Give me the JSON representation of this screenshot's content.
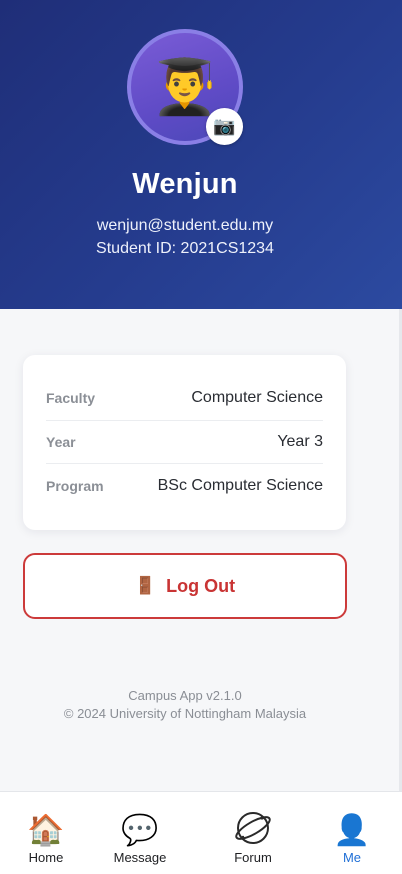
{
  "profile": {
    "avatar_emoji": "👨‍🎓",
    "camera_emoji": "📷",
    "name": "Wenjun",
    "email": "wenjun@student.edu.my",
    "student_id": "Student ID: 2021CS1234"
  },
  "info": {
    "rows": [
      {
        "label": "Faculty",
        "value": "Computer Science"
      },
      {
        "label": "Year",
        "value": "Year 3"
      },
      {
        "label": "Program",
        "value": "BSc Computer Science"
      }
    ]
  },
  "logout": {
    "icon": "🚪",
    "label": "Log Out"
  },
  "footer": {
    "version": "Campus App v2.1.0",
    "copyright": "© 2024 University of Nottingham Malaysia"
  },
  "tabs": [
    {
      "label": "Home",
      "icon": "🏠",
      "icon_name": "home-icon"
    },
    {
      "label": "Message",
      "icon": "💬",
      "icon_name": "message-icon"
    },
    {
      "label": "Forum",
      "icon": "planet-outline",
      "icon_name": "forum-icon"
    },
    {
      "label": "Me",
      "icon": "👤",
      "icon_name": "me-icon",
      "active": true
    }
  ],
  "colors": {
    "header_gradient_start": "#1f2e78",
    "header_gradient_end": "#2c4aa0",
    "logout_red": "#c93434",
    "active_tab_blue": "#1f6fd6"
  }
}
